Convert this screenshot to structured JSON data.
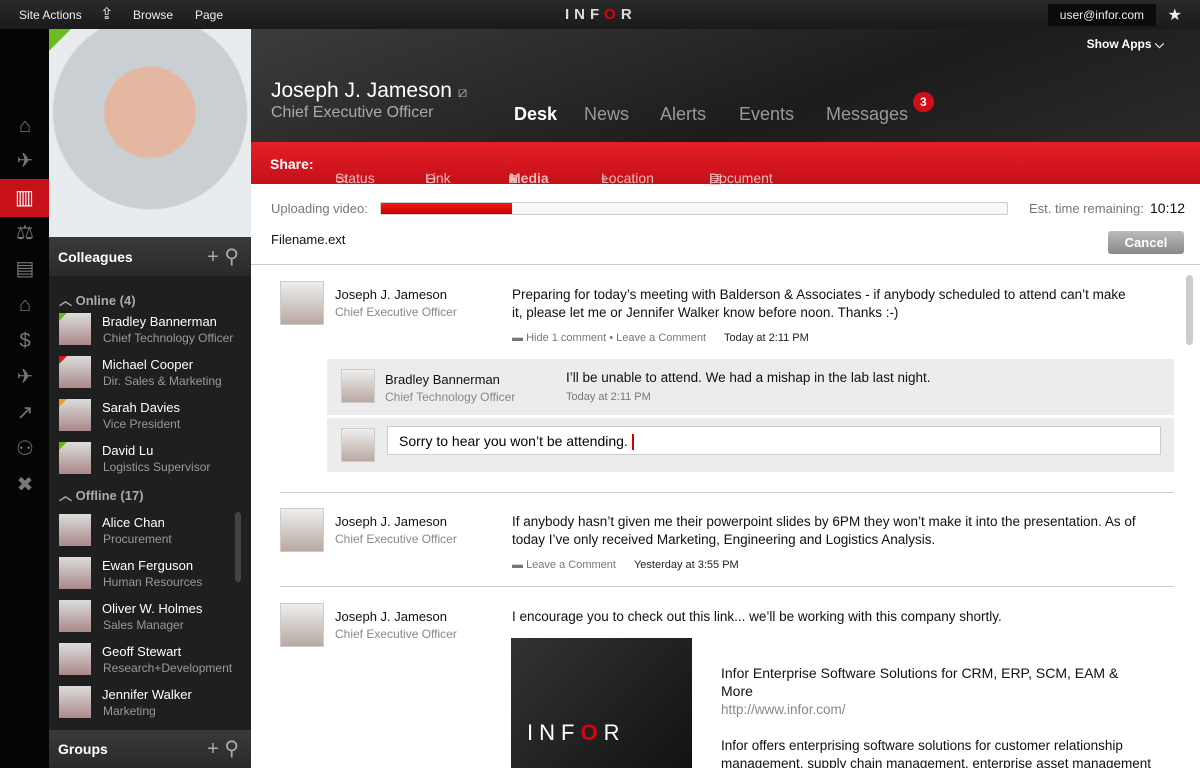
{
  "topbar": {
    "site_actions": "Site Actions",
    "browse": "Browse",
    "page": "Page",
    "logo": "INFOR",
    "user": "user@infor.com",
    "show_apps": "Show Apps"
  },
  "rail": [
    "home-icon",
    "plane-tools-icon",
    "office-icon",
    "scales-icon",
    "clipboard-icon",
    "bank-icon",
    "invoice-icon",
    "airplane-icon",
    "chart-icon",
    "people-icon",
    "tools-icon"
  ],
  "profile": {
    "name": "Joseph J. Jameson",
    "title": "Chief Executive Officer"
  },
  "nav": {
    "tabs": [
      "Desk",
      "News",
      "Alerts",
      "Events",
      "Messages"
    ],
    "messages_badge": "3"
  },
  "share": {
    "label": "Share:",
    "items": [
      "Status",
      "Link",
      "Media",
      "Location",
      "Document"
    ]
  },
  "upload": {
    "label": "Uploading video:",
    "progress_percent": 21,
    "est_label": "Est. time remaining:",
    "est_value": "10:12",
    "filename": "Filename.ext",
    "cancel": "Cancel"
  },
  "colleagues": {
    "title": "Colleagues",
    "online_label": "Online (4)",
    "offline_label": "Offline (17)",
    "groups": "Groups",
    "online": [
      {
        "name": "Bradley Bannerman",
        "role": "Chief Technology Officer"
      },
      {
        "name": "Michael Cooper",
        "role": "Dir. Sales & Marketing"
      },
      {
        "name": "Sarah Davies",
        "role": "Vice President"
      },
      {
        "name": "David Lu",
        "role": "Logistics Supervisor"
      }
    ],
    "offline": [
      {
        "name": "Alice Chan",
        "role": "Procurement"
      },
      {
        "name": "Ewan Ferguson",
        "role": "Human Resources"
      },
      {
        "name": "Oliver W. Holmes",
        "role": "Sales Manager"
      },
      {
        "name": "Geoff Stewart",
        "role": "Research+Development"
      },
      {
        "name": "Jennifer Walker",
        "role": "Marketing"
      }
    ]
  },
  "feed": {
    "post1": {
      "name": "Joseph J. Jameson",
      "role": "Chief Executive Officer",
      "text": "Preparing for today’s meeting with Balderson & Associates - if anybody scheduled to attend can’t make it, please let me or Jennifer Walker know before noon. Thanks :-)",
      "hide": "Hide 1 comment",
      "leave": "Leave a Comment",
      "time": "Today at 2:11 PM"
    },
    "comment": {
      "name": "Bradley Bannerman",
      "role": "Chief Technology Officer",
      "text": "I’ll be unable to attend. We had a mishap in the lab last night.",
      "time": "Today at 2:11 PM"
    },
    "reply": "Sorry to hear you won’t be attending.",
    "post2": {
      "name": "Joseph J. Jameson",
      "role": "Chief Executive Officer",
      "text": "If anybody hasn’t given me their powerpoint slides by 6PM they won’t make it into the presentation. As of today I’ve only received Marketing, Engineering and Logistics Analysis.",
      "leave": "Leave a Comment",
      "time": "Yesterday at 3:55 PM"
    },
    "post3": {
      "name": "Joseph J. Jameson",
      "role": "Chief Executive Officer",
      "text": "I encourage you to check out this link... we’ll be working with this company shortly.",
      "link_title": "Infor Enterprise Software Solutions for CRM, ERP, SCM, EAM & More",
      "link_url": "http://www.infor.com/",
      "link_desc": "Infor offers enterprising software solutions for customer relationship management, supply chain management, enterprise asset management"
    }
  }
}
